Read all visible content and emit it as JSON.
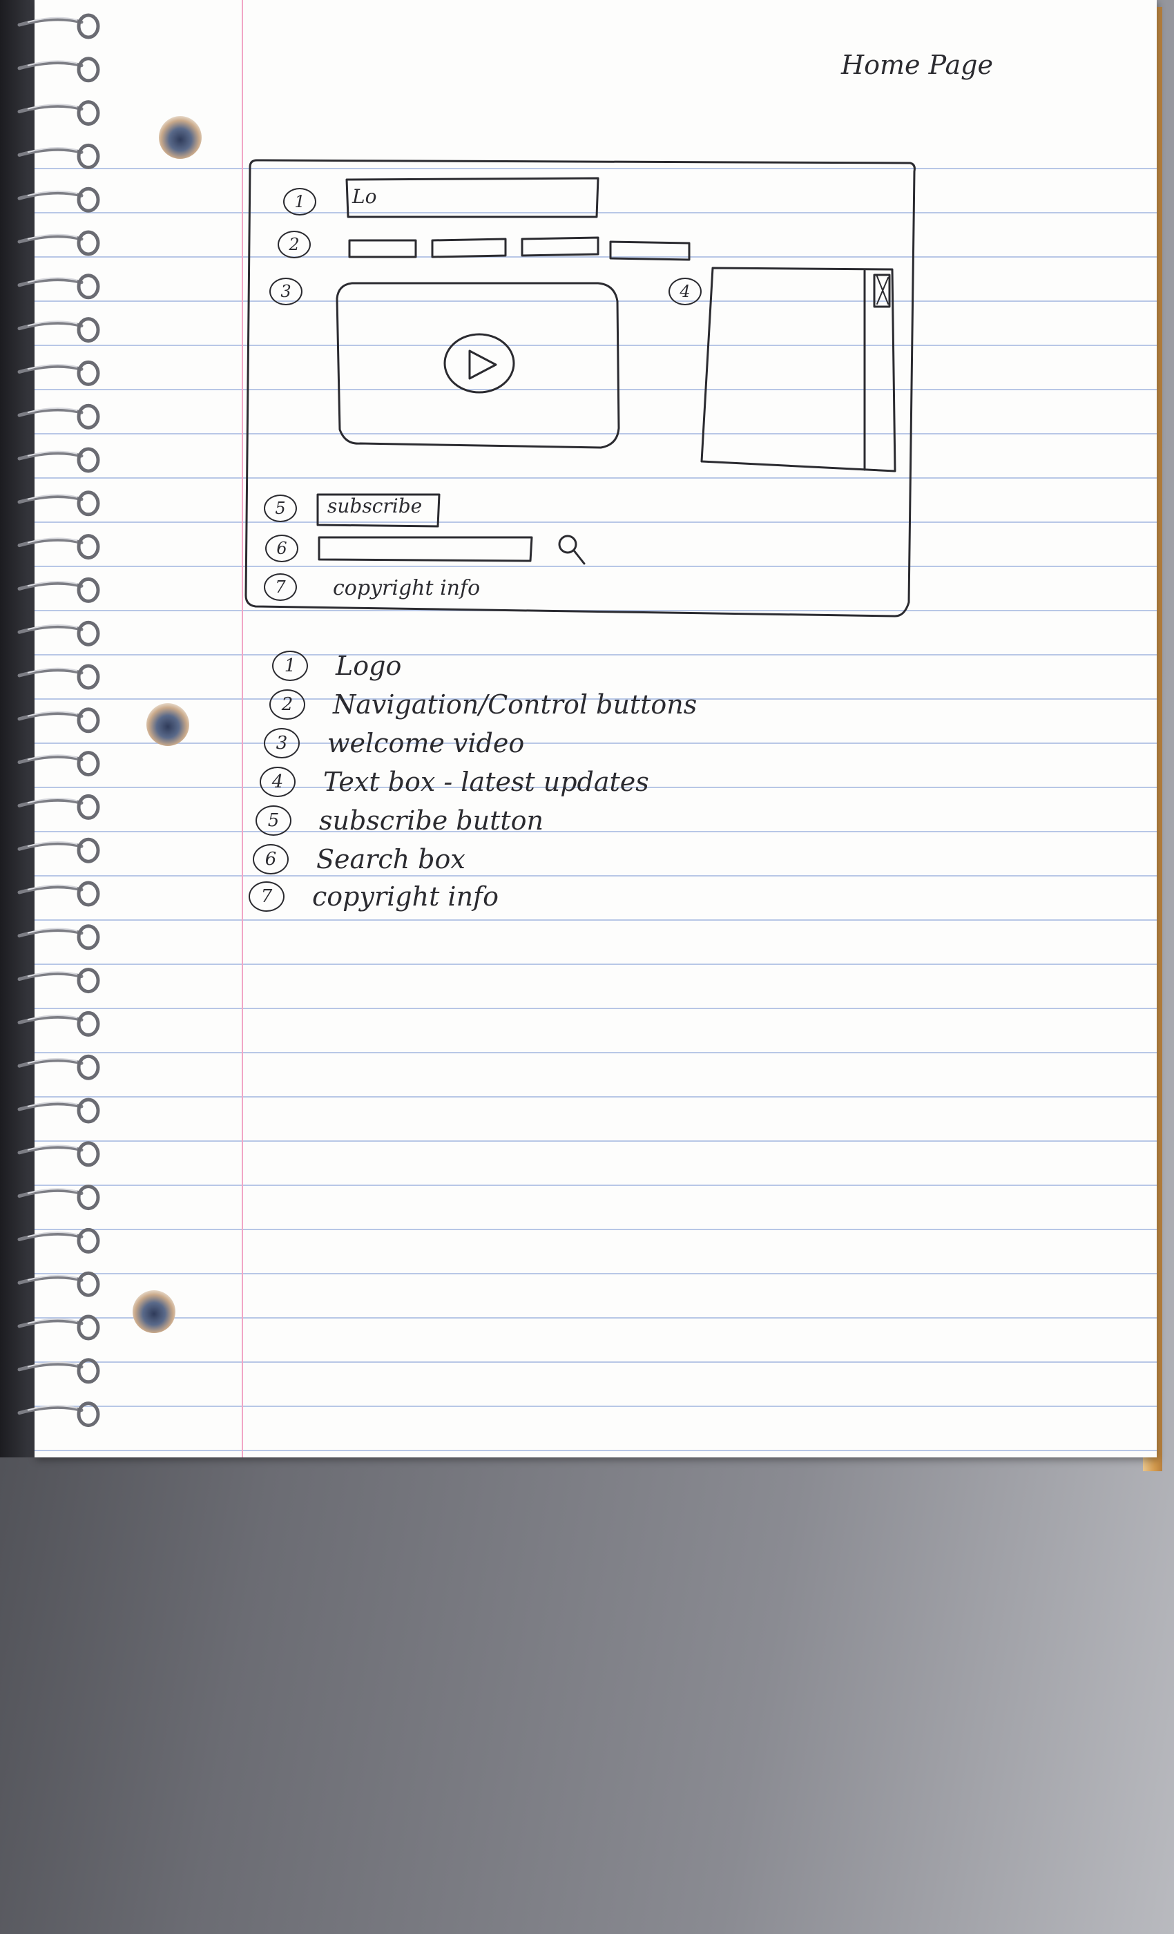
{
  "page_title": "Home Page",
  "wireframe": {
    "callouts": [
      "1",
      "2",
      "3",
      "4",
      "5",
      "6",
      "7"
    ],
    "logo_text": "Lo",
    "subscribe_button_label": "subscribe",
    "footer_text": "copyright info",
    "video_icon": "play-icon",
    "search_icon": "magnifier-icon",
    "scrollbar_icon": "scrollbar-thumb"
  },
  "legend": [
    {
      "num": "1",
      "label": "Logo"
    },
    {
      "num": "2",
      "label": "Navigation/Control buttons"
    },
    {
      "num": "3",
      "label": "welcome video"
    },
    {
      "num": "4",
      "label": "Text box - latest updates"
    },
    {
      "num": "5",
      "label": "subscribe button"
    },
    {
      "num": "6",
      "label": "Search box"
    },
    {
      "num": "7",
      "label": "copyright info"
    }
  ],
  "colors": {
    "paper": "#fdfdfc",
    "rule_line": "#b8c7e6",
    "margin_line": "#f1a6c5",
    "ink": "#2b2b30"
  }
}
